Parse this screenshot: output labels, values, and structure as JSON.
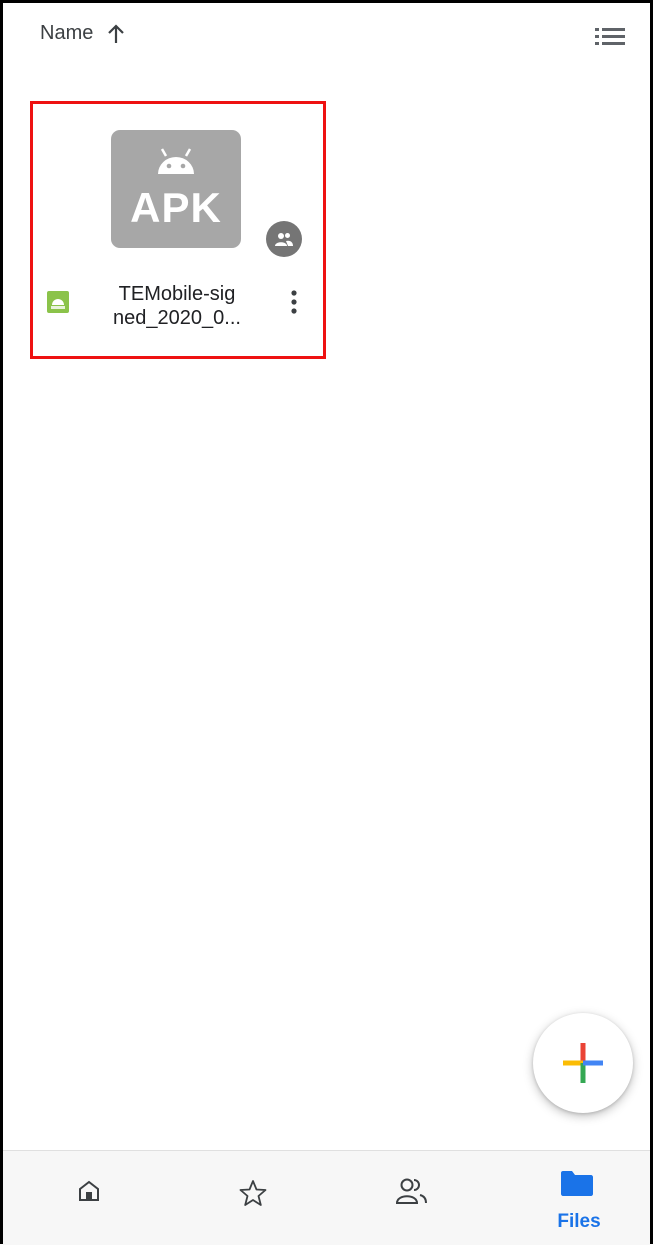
{
  "sort": {
    "label": "Name",
    "arrow_icon": "arrow-up-icon"
  },
  "view_toggle": {
    "icon": "list-view-icon"
  },
  "file": {
    "thumbnail_text": "APK",
    "name": "TEMobile-signed_2020_0...",
    "name_line1": "TEMobile-sig",
    "name_line2": "ned_2020_0...",
    "type_color": "#8bc34a",
    "highlight_color": "#ee1111"
  },
  "fab": {
    "icon": "plus-icon",
    "colors": [
      "#ea4335",
      "#fbbc04",
      "#34a853",
      "#4285f4"
    ]
  },
  "bottom_nav": {
    "items": [
      {
        "icon": "home-icon",
        "label": ""
      },
      {
        "icon": "star-icon",
        "label": ""
      },
      {
        "icon": "shared-icon",
        "label": ""
      },
      {
        "icon": "folder-icon",
        "label": "Files",
        "active": true
      }
    ],
    "active_color": "#1a73e8"
  }
}
